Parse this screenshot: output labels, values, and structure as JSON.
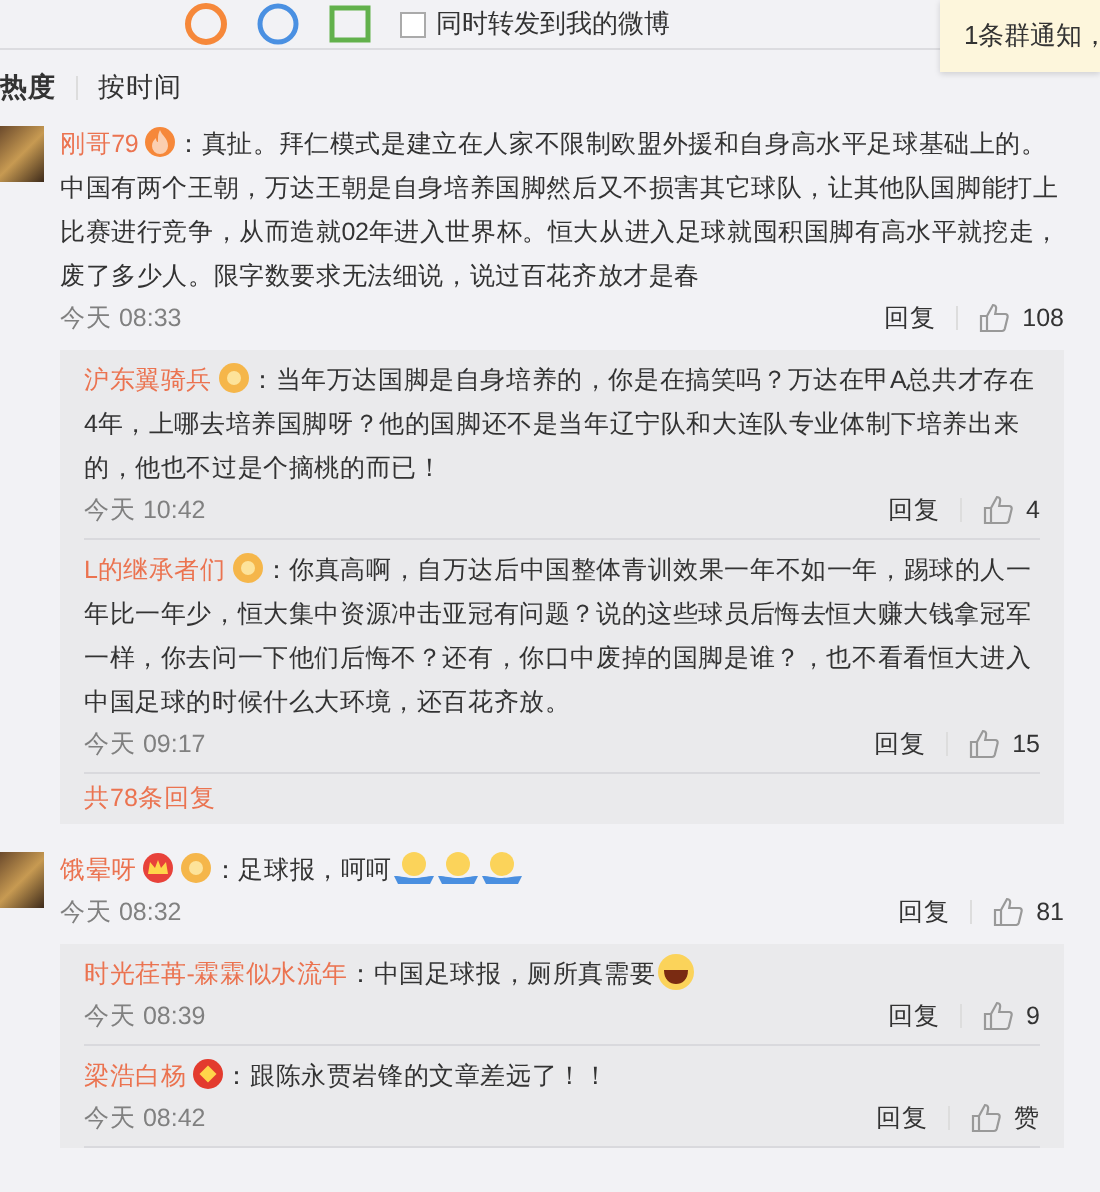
{
  "share_bar": {
    "checkbox_label": "同时转发到我的微博",
    "checked": false
  },
  "notification": {
    "text": "1条群通知，"
  },
  "sort_tabs": [
    {
      "label": "热度",
      "selected": true
    },
    {
      "label": "按时间",
      "selected": false
    }
  ],
  "comments": [
    {
      "author": "刚哥79",
      "text": "：真扯。拜仁模式是建立在人家不限制欧盟外援和自身高水平足球基础上的。中国有两个王朝，万达王朝是自身培养国脚然后又不损害其它球队，让其他队国脚能打上比赛进行竞争，从而造就02年进入世界杯。恒大从进入足球就囤积国脚有高水平就挖走，废了多少人。限字数要求无法细说，说过百花齐放才是春",
      "time": "今天 08:33",
      "reply_label": "回复",
      "likes": "108",
      "replies": [
        {
          "author": "沪东翼骑兵",
          "text": "：当年万达国脚是自身培养的，你是在搞笑吗？万达在甲A总共才存在4年，上哪去培养国脚呀？他的国脚还不是当年辽宁队和大连队专业体制下培养出来的，他也不过是个摘桃的而已！",
          "time": "今天 10:42",
          "reply_label": "回复",
          "likes": "4"
        },
        {
          "author": "L的继承者们",
          "text": "：你真高啊，自万达后中国整体青训效果一年不如一年，踢球的人一年比一年少，恒大集中资源冲击亚冠有问题？说的这些球员后悔去恒大赚大钱拿冠军一样，你去问一下他们后悔不？还有，你口中废掉的国脚是谁？，也不看看恒大进入中国足球的时候什么大环境，还百花齐放。",
          "time": "今天 09:17",
          "reply_label": "回复",
          "likes": "15"
        }
      ],
      "more_link": "共78条回复"
    },
    {
      "author": "饿晕呀",
      "text": "：足球报，呵呵",
      "time": "今天 08:32",
      "reply_label": "回复",
      "likes": "81",
      "replies": [
        {
          "author": "时光荏苒-霖霖似水流年",
          "text": "：中国足球报，厕所真需要",
          "time": "今天 08:39",
          "reply_label": "回复",
          "likes": "9"
        },
        {
          "author": "梁浩白杨",
          "text": "：跟陈永贾岩锋的文章差远了！！",
          "time": "今天 08:42",
          "reply_label": "回复",
          "likes": "赞"
        }
      ]
    }
  ]
}
